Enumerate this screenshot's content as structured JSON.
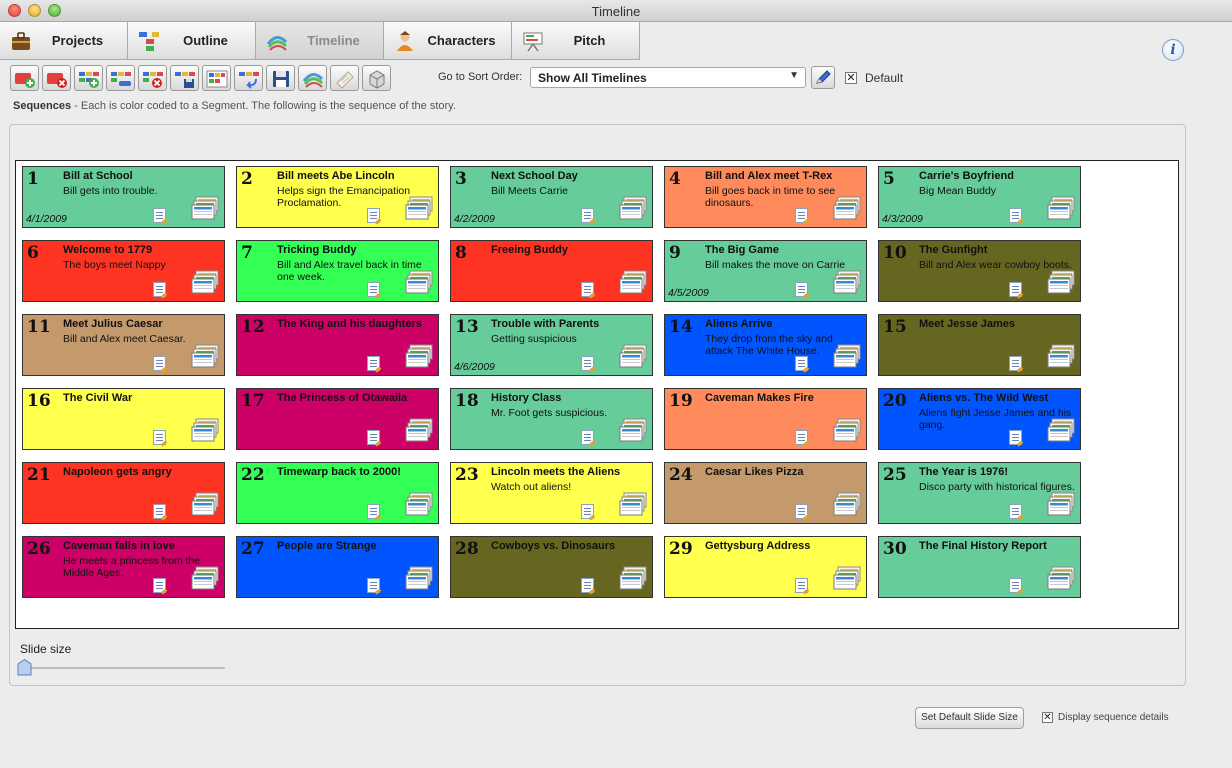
{
  "window": {
    "title": "Timeline"
  },
  "tabs": [
    {
      "label": "Projects",
      "icon": "briefcase-icon",
      "active": false
    },
    {
      "label": "Outline",
      "icon": "outline-icon",
      "active": false
    },
    {
      "label": "Timeline",
      "icon": "timeline-icon",
      "active": true
    },
    {
      "label": "Characters",
      "icon": "character-icon",
      "active": false
    },
    {
      "label": "Pitch",
      "icon": "pitch-icon",
      "active": false
    }
  ],
  "toolbar": {
    "tools": [
      "add-timeline-icon",
      "delete-timeline-icon",
      "add-sequence-icon",
      "remove-sequence-icon",
      "delete-sequence-icon",
      "save-sequence-icon",
      "sequence-grid-icon",
      "import-sequence-icon",
      "save-icon",
      "colors-icon",
      "paper-icon",
      "box-icon"
    ],
    "sort_label": "Go to Sort Order:",
    "sort_value": "Show All Timelines",
    "default_checked": true,
    "default_label": "Default"
  },
  "sequences_header": {
    "label": "Sequences",
    "text": " - Each is color coded to a Segment. The following is the sequence of the story."
  },
  "colors": {
    "teal": "#66cc99",
    "yellow": "#ffff4d",
    "salmon": "#ff8a5c",
    "red": "#ff3322",
    "green": "#33ff55",
    "olive": "#666620",
    "tan": "#c49a6c",
    "magenta": "#cc0066",
    "blue": "#0055ff"
  },
  "cards": [
    {
      "num": "1",
      "title": "Bill at School",
      "desc": "Bill gets into trouble.",
      "date": "4/1/2009",
      "color": "teal"
    },
    {
      "num": "2",
      "title": "Bill meets Abe Lincoln",
      "desc": "Helps sign the Emancipation Proclamation.",
      "date": "",
      "color": "yellow"
    },
    {
      "num": "3",
      "title": "Next School Day",
      "desc": "Bill Meets Carrie",
      "date": "4/2/2009",
      "color": "teal"
    },
    {
      "num": "4",
      "title": "Bill and Alex meet T-Rex",
      "desc": "Bill goes back in time to see dinosaurs.",
      "date": "",
      "color": "salmon"
    },
    {
      "num": "5",
      "title": "Carrie's Boyfriend",
      "desc": "Big Mean Buddy",
      "date": "4/3/2009",
      "color": "teal"
    },
    {
      "num": "6",
      "title": "Welcome to 1779",
      "desc": "The boys meet Nappy",
      "date": "",
      "color": "red"
    },
    {
      "num": "7",
      "title": "Tricking Buddy",
      "desc": "Bill and Alex travel back in time one week.",
      "date": "",
      "color": "green"
    },
    {
      "num": "8",
      "title": "Freeing Buddy",
      "desc": "",
      "date": "",
      "color": "red"
    },
    {
      "num": "9",
      "title": "The Big Game",
      "desc": "Bill makes the move on Carrie",
      "date": "4/5/2009",
      "color": "teal"
    },
    {
      "num": "10",
      "title": "The Gunfight",
      "desc": "Bill and Alex wear cowboy boots.",
      "date": "",
      "color": "olive"
    },
    {
      "num": "11",
      "title": "Meet Julius Caesar",
      "desc": "Bill and Alex meet Caesar.",
      "date": "",
      "color": "tan"
    },
    {
      "num": "12",
      "title": "The King and his daughters",
      "desc": "",
      "date": "",
      "color": "magenta"
    },
    {
      "num": "13",
      "title": "Trouble with Parents",
      "desc": "Getting suspicious",
      "date": "4/6/2009",
      "color": "teal"
    },
    {
      "num": "14",
      "title": "Aliens Arrive",
      "desc": "They drop from the sky and attack The White House.",
      "date": "",
      "color": "blue"
    },
    {
      "num": "15",
      "title": "Meet Jesse James",
      "desc": "",
      "date": "",
      "color": "olive"
    },
    {
      "num": "16",
      "title": "The Civil War",
      "desc": "",
      "date": "",
      "color": "yellow"
    },
    {
      "num": "17",
      "title": "The Princess of Otawaila",
      "desc": "",
      "date": "",
      "color": "magenta"
    },
    {
      "num": "18",
      "title": "History Class",
      "desc": "Mr. Foot gets suspicious.",
      "date": "",
      "color": "teal"
    },
    {
      "num": "19",
      "title": "Caveman Makes Fire",
      "desc": "",
      "date": "",
      "color": "salmon"
    },
    {
      "num": "20",
      "title": "Aliens vs. The Wild West",
      "desc": "Aliens fight Jesse James and his gang.",
      "date": "",
      "color": "blue"
    },
    {
      "num": "21",
      "title": "Napoleon gets angry",
      "desc": "",
      "date": "",
      "color": "red"
    },
    {
      "num": "22",
      "title": "Timewarp back to 2000!",
      "desc": "",
      "date": "",
      "color": "green"
    },
    {
      "num": "23",
      "title": "Lincoln meets the Aliens",
      "desc": "Watch out aliens!",
      "date": "",
      "color": "yellow"
    },
    {
      "num": "24",
      "title": "Caesar Likes Pizza",
      "desc": "",
      "date": "",
      "color": "tan"
    },
    {
      "num": "25",
      "title": "The Year is 1976!",
      "desc": "Disco party with historical figures.",
      "date": "",
      "color": "teal"
    },
    {
      "num": "26",
      "title": "Caveman falls in love",
      "desc": "He meets a princess from the Middle Ages.",
      "date": "",
      "color": "magenta"
    },
    {
      "num": "27",
      "title": "People are Strange",
      "desc": "",
      "date": "",
      "color": "blue"
    },
    {
      "num": "28",
      "title": "Cowboys vs. Dinosaurs",
      "desc": "",
      "date": "",
      "color": "olive"
    },
    {
      "num": "29",
      "title": "Gettysburg Address",
      "desc": "",
      "date": "",
      "color": "yellow"
    },
    {
      "num": "30",
      "title": "The Final History Report",
      "desc": "",
      "date": "",
      "color": "teal"
    }
  ],
  "slide_size": {
    "label": "Slide size",
    "value": 0
  },
  "footer": {
    "default_size_button": "Set Default Slide Size",
    "display_details_checked": true,
    "display_details_label": "Display sequence details"
  }
}
